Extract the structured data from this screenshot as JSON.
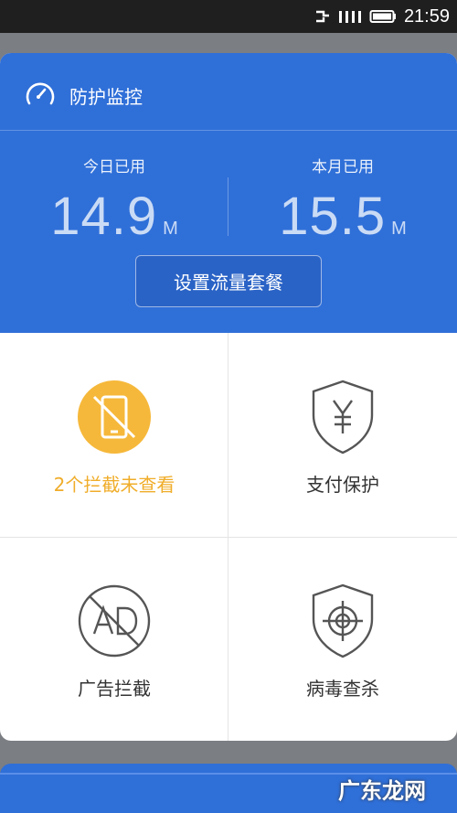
{
  "status_bar": {
    "time": "21:59",
    "icons": [
      "usb-icon",
      "signal-icon",
      "battery-icon"
    ]
  },
  "card": {
    "header": {
      "title": "防护监控",
      "icon": "speedometer-icon",
      "today": {
        "label": "今日已用",
        "value": "14.9",
        "unit": "M"
      },
      "month": {
        "label": "本月已用",
        "value": "15.5",
        "unit": "M"
      },
      "plan_button": "设置流量套餐"
    },
    "tiles": [
      {
        "label": "2个拦截未查看",
        "icon": "blocked-phone-icon",
        "status_color": "#f0ad2a"
      },
      {
        "label": "支付保护",
        "icon": "yuan-shield-icon"
      },
      {
        "label": "广告拦截",
        "icon": "ad-block-icon"
      },
      {
        "label": "病毒查杀",
        "icon": "crosshair-shield-icon"
      }
    ]
  },
  "watermark": "广东龙网",
  "colors": {
    "accent": "#2f6fd8",
    "warning": "#f0ad2a"
  }
}
